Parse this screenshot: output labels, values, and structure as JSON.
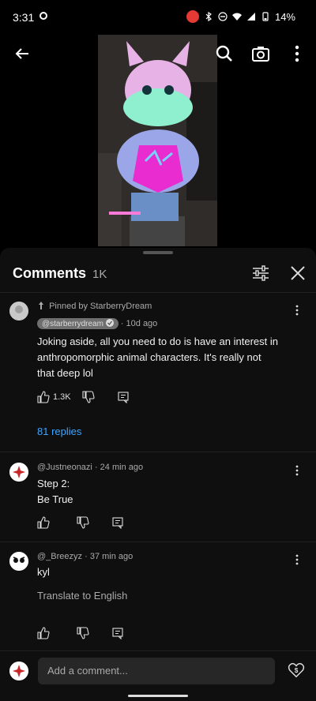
{
  "status_bar": {
    "time": "3:31",
    "battery": "14%"
  },
  "header": {
    "title": "Comments",
    "count": "1K"
  },
  "comments": [
    {
      "pinned_label": "Pinned by StarberryDream",
      "author": "@starberrydream",
      "time": "10d ago",
      "text_line1": "Joking aside, all you need to do is have an interest in",
      "text_line2": "anthropomorphic animal characters. It's really not",
      "text_line3": "that deep lol",
      "likes": "1.3K",
      "replies": "81 replies"
    },
    {
      "author": "@Justneonazi",
      "time": "24 min ago",
      "text_line1": "Step 2:",
      "text_line2": "Be True"
    },
    {
      "author": "@_Breezyz",
      "time": "37 min ago",
      "text_line1": "kyl",
      "translate": "Translate to English"
    }
  ],
  "composer": {
    "placeholder": "Add a comment..."
  },
  "colors": {
    "background": "#0f0f0f",
    "link": "#3ea6ff",
    "muted": "#aaaaaa",
    "badge_red": "#e53935"
  }
}
